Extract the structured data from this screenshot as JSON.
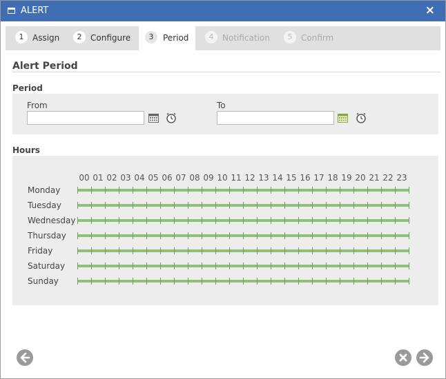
{
  "window": {
    "title": "ALERT",
    "close_label": "×"
  },
  "steps": [
    {
      "num": "1",
      "label": "Assign",
      "state": "done"
    },
    {
      "num": "2",
      "label": "Configure",
      "state": "done"
    },
    {
      "num": "3",
      "label": "Period",
      "state": "active"
    },
    {
      "num": "4",
      "label": "Notification",
      "state": "disabled"
    },
    {
      "num": "5",
      "label": "Confirm",
      "state": "disabled"
    }
  ],
  "alert_period": {
    "title": "Alert Period",
    "period_label": "Period",
    "from": {
      "label": "From",
      "value": "",
      "placeholder": ""
    },
    "to": {
      "label": "To",
      "value": "",
      "placeholder": ""
    }
  },
  "hours": {
    "label": "Hours",
    "hour_labels": [
      "00",
      "01",
      "02",
      "03",
      "04",
      "05",
      "06",
      "07",
      "08",
      "09",
      "10",
      "11",
      "12",
      "13",
      "14",
      "15",
      "16",
      "17",
      "18",
      "19",
      "20",
      "21",
      "22",
      "23"
    ],
    "days": [
      "Monday",
      "Tuesday",
      "Wednesday",
      "Thursday",
      "Friday",
      "Saturday",
      "Sunday"
    ],
    "bar_color": "#8dc07b"
  },
  "icons": {
    "calendar": "calendar-icon",
    "clock": "clock-icon",
    "back": "arrow-left-icon",
    "cancel": "cancel-x-icon",
    "next": "arrow-right-icon"
  }
}
